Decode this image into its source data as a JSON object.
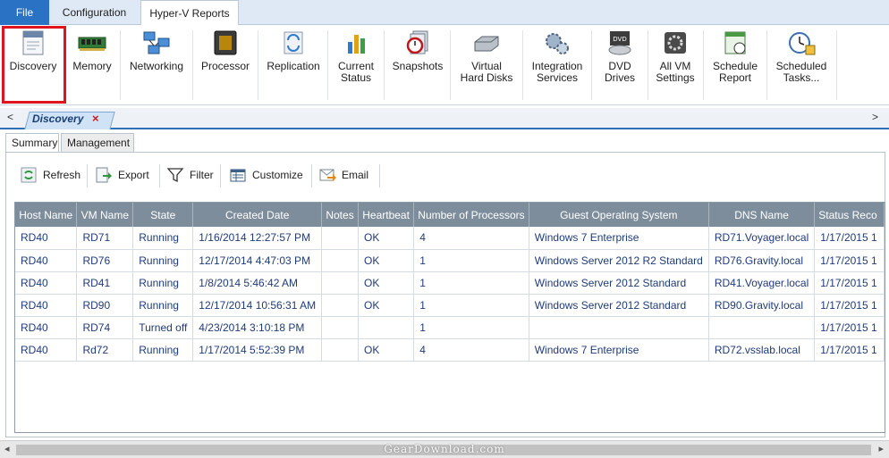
{
  "menu": {
    "file": "File",
    "configuration": "Configuration",
    "hyperv_reports": "Hyper-V Reports"
  },
  "ribbon": [
    {
      "label": "Discovery",
      "icon": "discovery-icon"
    },
    {
      "label": "Memory",
      "icon": "memory-icon"
    },
    {
      "label": "Networking",
      "icon": "networking-icon"
    },
    {
      "label": "Processor",
      "icon": "processor-icon"
    },
    {
      "label": "Replication",
      "icon": "replication-icon"
    },
    {
      "label": "Current\nStatus",
      "icon": "current-status-icon"
    },
    {
      "label": "Snapshots",
      "icon": "snapshots-icon"
    },
    {
      "label": "Virtual\nHard Disks",
      "icon": "virtual-hard-disks-icon"
    },
    {
      "label": "Integration\nServices",
      "icon": "integration-services-icon"
    },
    {
      "label": "DVD\nDrives",
      "icon": "dvd-drives-icon"
    },
    {
      "label": "All VM\nSettings",
      "icon": "all-vm-settings-icon"
    },
    {
      "label": "Schedule\nReport",
      "icon": "schedule-report-icon"
    },
    {
      "label": "Scheduled\nTasks...",
      "icon": "scheduled-tasks-icon"
    }
  ],
  "doc_tab": {
    "label": "Discovery",
    "close": "×"
  },
  "nav": {
    "left": "<",
    "right": ">"
  },
  "sub_tabs": [
    "Summary",
    "Management"
  ],
  "toolbar": {
    "refresh": "Refresh",
    "export": "Export",
    "filter": "Filter",
    "customize": "Customize",
    "email": "Email"
  },
  "table": {
    "columns": [
      "Host Name",
      "VM Name",
      "State",
      "Created Date",
      "Notes",
      "Heartbeat",
      "Number of Processors",
      "Guest Operating System",
      "DNS Name",
      "Status Reco"
    ],
    "rows": [
      [
        "RD40",
        "RD71",
        "Running",
        "1/16/2014 12:27:57 PM",
        "",
        "OK",
        "4",
        "Windows 7 Enterprise",
        "RD71.Voyager.local",
        "1/17/2015 1"
      ],
      [
        "RD40",
        "RD76",
        "Running",
        "12/17/2014 4:47:03 PM",
        "",
        "OK",
        "1",
        "Windows Server 2012 R2 Standard",
        "RD76.Gravity.local",
        "1/17/2015 1"
      ],
      [
        "RD40",
        "RD41",
        "Running",
        "1/8/2014 5:46:42 AM",
        "",
        "OK",
        "1",
        "Windows Server 2012 Standard",
        "RD41.Voyager.local",
        "1/17/2015 1"
      ],
      [
        "RD40",
        "RD90",
        "Running",
        "12/17/2014 10:56:31 AM",
        "",
        "OK",
        "1",
        "Windows Server 2012 Standard",
        "RD90.Gravity.local",
        "1/17/2015 1"
      ],
      [
        "RD40",
        "RD74",
        "Turned off",
        "4/23/2014 3:10:18 PM",
        "",
        "",
        "1",
        "",
        "",
        "1/17/2015 1"
      ],
      [
        "RD40",
        "Rd72",
        "Running",
        "1/17/2014 5:52:39 PM",
        "",
        "OK",
        "4",
        "Windows 7 Enterprise",
        "RD72.vsslab.local",
        "1/17/2015 1"
      ]
    ]
  },
  "scroll": {
    "left": "◂",
    "right": "▸"
  },
  "watermark": "GearDownload.com",
  "colors": {
    "file_tab": "#2a73c4",
    "header_bg": "#7e8d9c",
    "cell_text": "#1f3b7a",
    "highlight": "#e0141e"
  }
}
